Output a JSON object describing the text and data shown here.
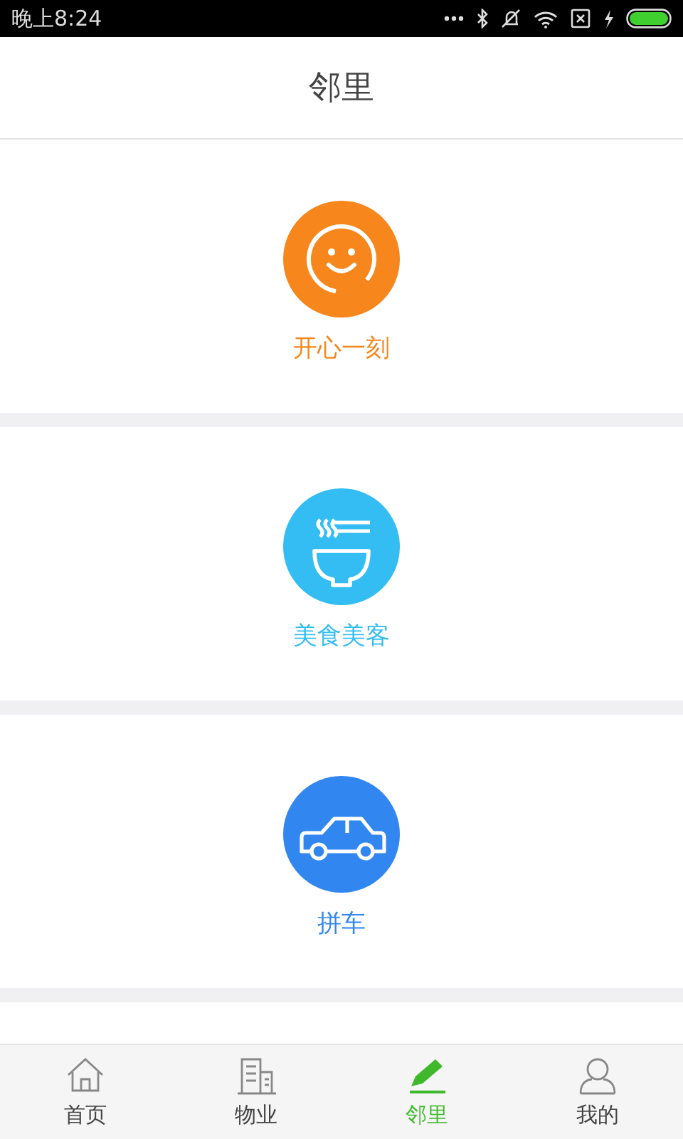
{
  "status_bar": {
    "time": "晚上8:24"
  },
  "header": {
    "title": "邻里"
  },
  "features": [
    {
      "label": "开心一刻",
      "kind": "smile",
      "color": "#f7861c"
    },
    {
      "label": "美食美客",
      "kind": "noodles",
      "color": "#34bdf2"
    },
    {
      "label": "拼车",
      "kind": "car",
      "color": "#3286f0"
    }
  ],
  "tab_bar": [
    {
      "label": "首页",
      "kind": "home",
      "selected": false
    },
    {
      "label": "物业",
      "kind": "building",
      "selected": false
    },
    {
      "label": "邻里",
      "kind": "pencil",
      "selected": true
    },
    {
      "label": "我的",
      "kind": "person",
      "selected": false
    }
  ]
}
